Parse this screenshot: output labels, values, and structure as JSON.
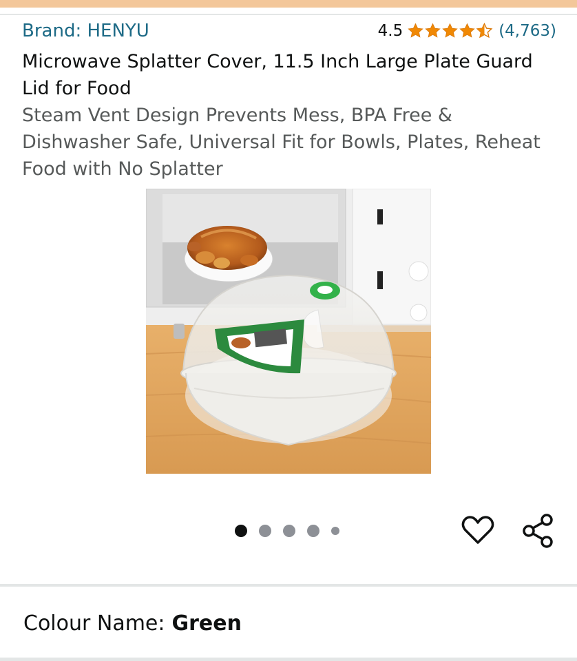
{
  "product": {
    "brand_label": "Brand: HENYU",
    "rating_value": "4.5",
    "rating_stars": 4.5,
    "rating_count": "(4,763)",
    "title": "Microwave Splatter Cover, 11.5 Inch Large Plate Guard Lid for Food",
    "subtitle": "Steam Vent Design Prevents Mess, BPA Free & Dishwasher Safe, Universal Fit for Bowls, Plates, Reheat Food with No Splatter"
  },
  "gallery": {
    "image_icon": "microwave-splatter-cover-photo",
    "total_images": 5,
    "active_index": 0
  },
  "actions": {
    "wishlist_icon": "heart-icon",
    "share_icon": "share-icon"
  },
  "variation": {
    "label": "Colour Name:",
    "value": "Green"
  },
  "colors": {
    "link": "#1d6a86",
    "star": "#f08804",
    "header_strip": "#f3c79a"
  }
}
